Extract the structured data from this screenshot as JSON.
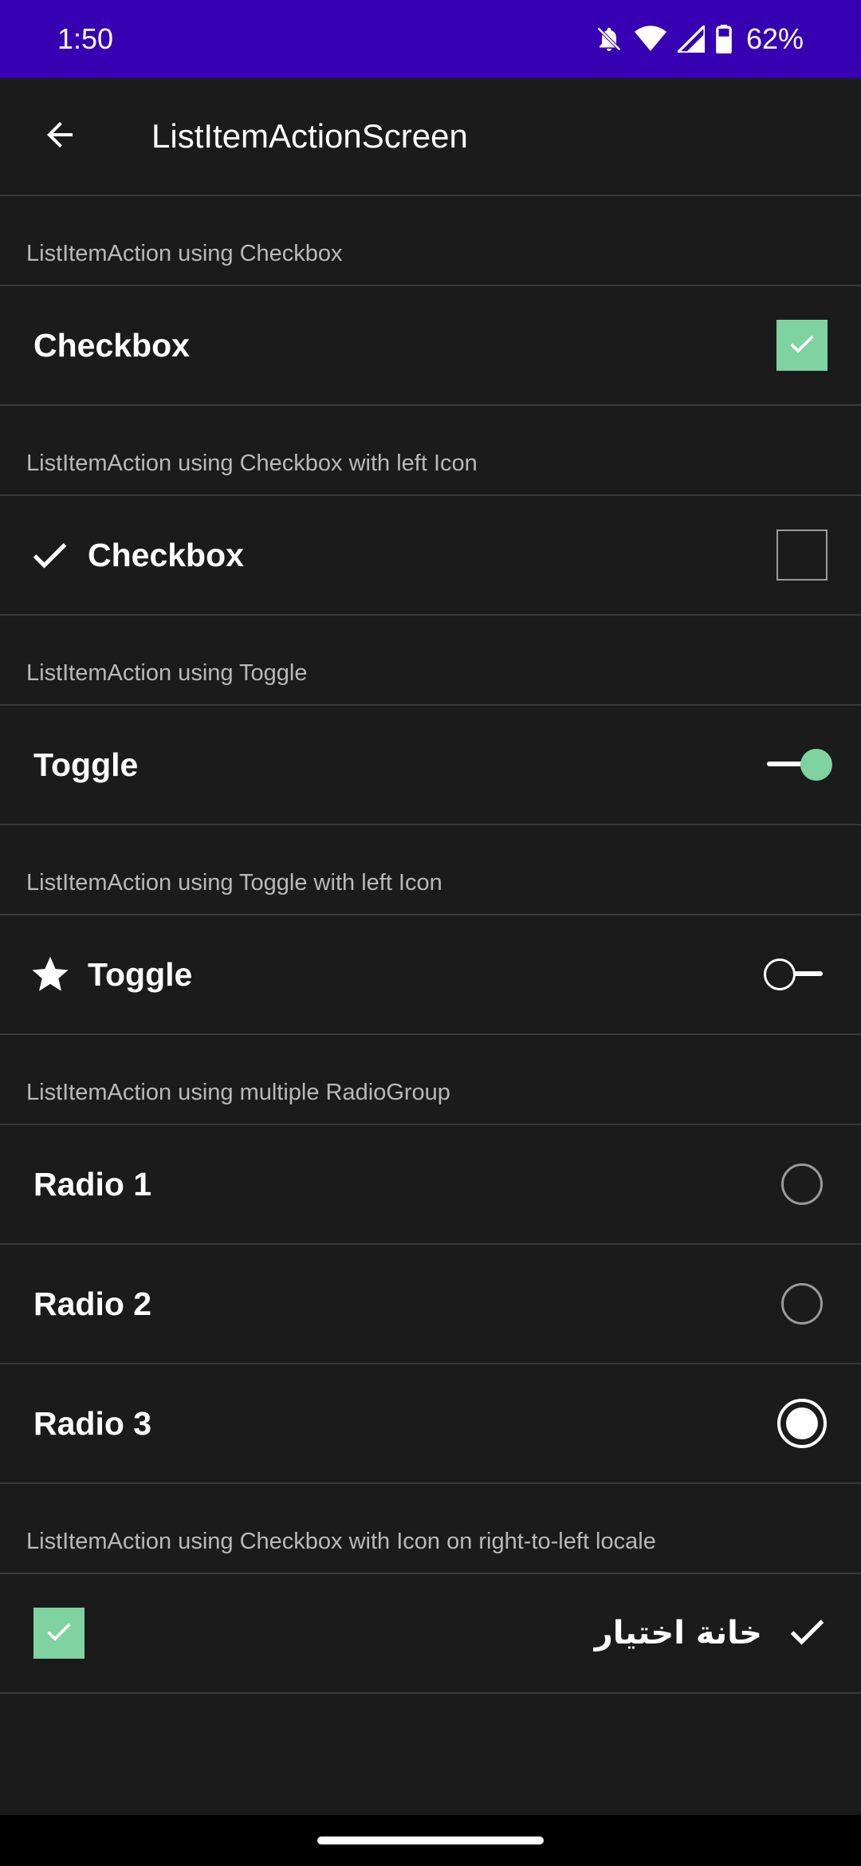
{
  "status_bar": {
    "time": "1:50",
    "battery_percent": "62%",
    "icons": [
      "bell-off-icon",
      "wifi-icon",
      "signal-icon",
      "battery-icon"
    ],
    "background": "#3700b3"
  },
  "app_bar": {
    "title": "ListItemActionScreen",
    "back_icon": "arrow-left-icon"
  },
  "sections": {
    "checkbox": {
      "header": "ListItemAction using Checkbox",
      "label": "Checkbox",
      "checked": true
    },
    "checkbox_icon": {
      "header": "ListItemAction using Checkbox with left Icon",
      "label": "Checkbox",
      "icon": "check-icon",
      "checked": false
    },
    "toggle": {
      "header": "ListItemAction using Toggle",
      "label": "Toggle",
      "on": true
    },
    "toggle_icon": {
      "header": "ListItemAction using Toggle with left Icon",
      "label": "Toggle",
      "icon": "star-icon",
      "on": false
    },
    "radio": {
      "header": "ListItemAction using multiple RadioGroup",
      "items": [
        {
          "label": "Radio 1",
          "selected": false
        },
        {
          "label": "Radio 2",
          "selected": false
        },
        {
          "label": "Radio 3",
          "selected": true
        }
      ]
    },
    "rtl": {
      "header": "ListItemAction using Checkbox with Icon on right-to-left locale",
      "label": "خانة اختيار",
      "icon": "check-icon",
      "checked": true
    }
  },
  "colors": {
    "accent": "#7ed3a0",
    "background": "#1b1b1b",
    "divider": "#3a3a3a",
    "header_text": "#b9b9b9"
  }
}
